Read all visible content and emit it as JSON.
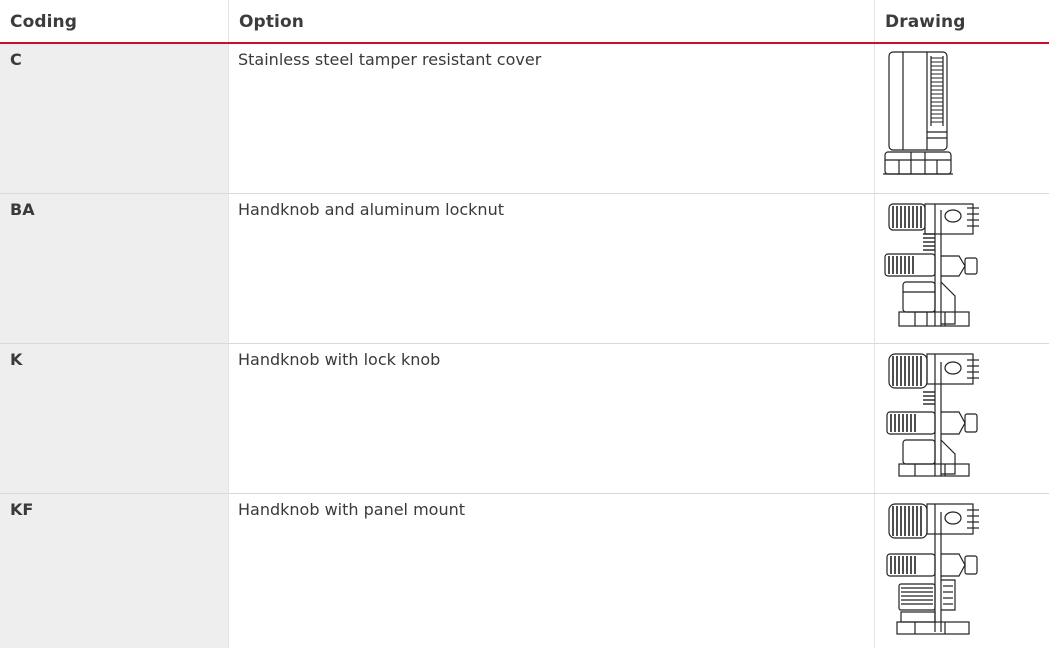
{
  "table": {
    "headers": {
      "coding": "Coding",
      "option": "Option",
      "drawing": "Drawing"
    },
    "rows": [
      {
        "coding": "C",
        "option": "Stainless steel tamper resistant cover",
        "drawing_icon": "tamper-resistant-cover-drawing"
      },
      {
        "coding": "BA",
        "option": "Handknob and aluminum locknut",
        "drawing_icon": "handknob-locknut-drawing"
      },
      {
        "coding": "K",
        "option": "Handknob with lock knob",
        "drawing_icon": "handknob-lock-knob-drawing"
      },
      {
        "coding": "KF",
        "option": "Handknob with panel mount",
        "drawing_icon": "handknob-panel-mount-drawing"
      }
    ]
  },
  "colors": {
    "header_rule": "#c8102e",
    "coding_column_bg": "#eeeeee",
    "text": "#3c3c3c"
  }
}
